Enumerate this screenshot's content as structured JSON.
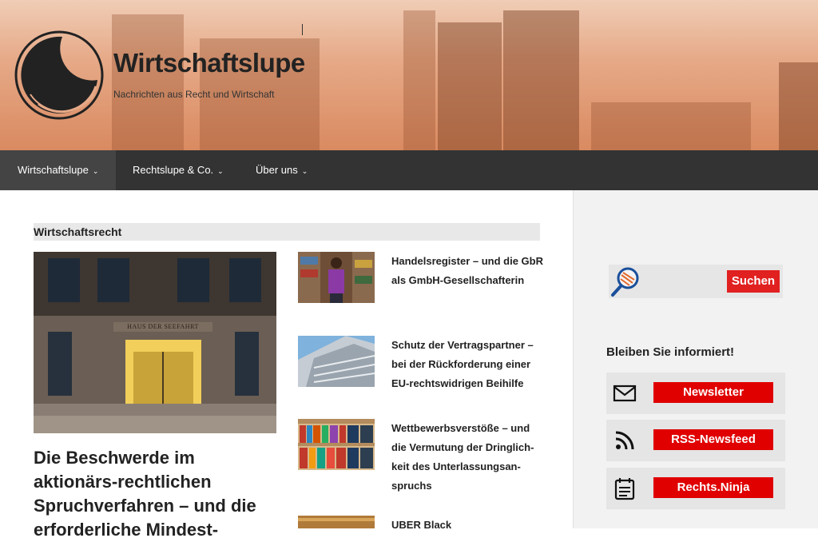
{
  "site": {
    "title": "Wirtschaftslupe",
    "description": "Nachrichten aus Recht und Wirtschaft"
  },
  "nav": {
    "items": [
      {
        "label": "Wirtschaftslupe",
        "active": true
      },
      {
        "label": "Rechtslupe & Co.",
        "active": false
      },
      {
        "label": "Über uns",
        "active": false
      }
    ]
  },
  "main": {
    "section_title": "Wirtschaftsrecht",
    "featured": {
      "title": "Die Beschwerde im aktionärs-rechtlichen Spruchverfahren – und die erforderliche Mindest-",
      "sign_text": "HAUS DER SEEFAHRT"
    },
    "posts": [
      {
        "title": "Handelsregister – und die GbR als GmbH-Gesellschafterin"
      },
      {
        "title": "Schutz der Vertragspartner – bei der Rückforderung einer EU-rechtswidrigen Beihilfe"
      },
      {
        "title": "Wettbewerbsverstöße – und die Vermutung der Dringlich-keit des Unterlassungsan-spruchs"
      },
      {
        "title": "UBER Black"
      }
    ]
  },
  "sidebar": {
    "search_button": "Suchen",
    "subscribe_title": "Bleiben Sie informiert!",
    "subscribe": [
      {
        "label": "Newsletter",
        "icon": "envelope-icon"
      },
      {
        "label": "RSS-Newsfeed",
        "icon": "rss-icon"
      },
      {
        "label": "Rechts.Ninja",
        "icon": "calendar-icon"
      }
    ]
  },
  "colors": {
    "nav_bg": "#333333",
    "accent_red": "#e00000",
    "header_tint": "#e6a987"
  }
}
